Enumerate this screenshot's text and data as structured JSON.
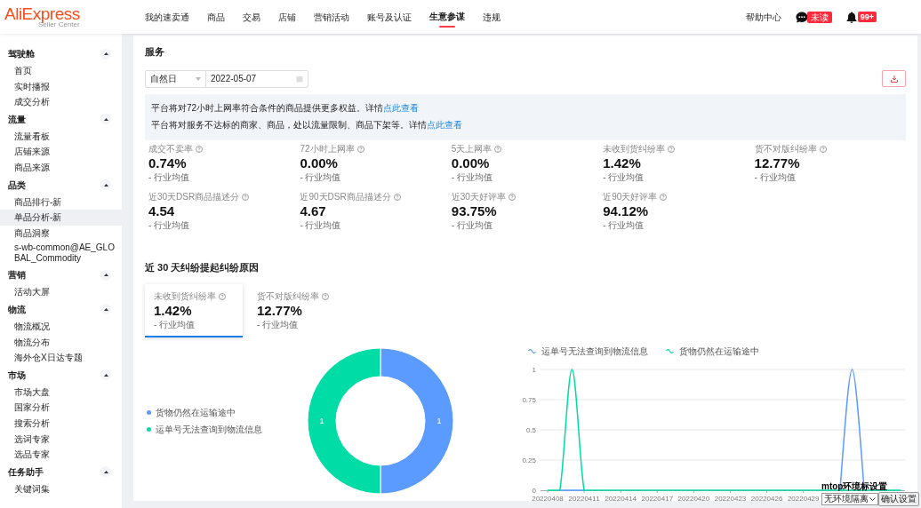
{
  "header": {
    "logo": "AliExpress",
    "logo_subtitle": "Seller Center",
    "nav": [
      {
        "label": "我的速卖通",
        "selected": false
      },
      {
        "label": "商品",
        "selected": false
      },
      {
        "label": "交易",
        "selected": false
      },
      {
        "label": "店铺",
        "selected": false
      },
      {
        "label": "营销活动",
        "selected": false
      },
      {
        "label": "账号及认证",
        "selected": false
      },
      {
        "label": "生意参谋",
        "selected": true
      },
      {
        "label": "违规",
        "selected": false
      }
    ],
    "help": "帮助中心",
    "messages_badge": "未读",
    "notifications_badge": "99+"
  },
  "sidebar": {
    "groups": [
      {
        "label": "驾驶舱",
        "expanded": true,
        "items": [
          {
            "label": "首页",
            "selected": false
          },
          {
            "label": "实时播报",
            "selected": false
          },
          {
            "label": "成交分析",
            "selected": false
          }
        ]
      },
      {
        "label": "流量",
        "expanded": true,
        "items": [
          {
            "label": "流量看板",
            "selected": false
          },
          {
            "label": "店铺来源",
            "selected": false
          },
          {
            "label": "商品来源",
            "selected": false
          }
        ]
      },
      {
        "label": "品类",
        "expanded": true,
        "items": [
          {
            "label": "商品排行-新",
            "selected": false
          },
          {
            "label": "单品分析-新",
            "selected": true
          },
          {
            "label": "商品洞察",
            "selected": false
          },
          {
            "label": "s-wb-common@AE_GLOBAL_Commodity",
            "selected": false
          }
        ]
      },
      {
        "label": "营销",
        "expanded": true,
        "items": [
          {
            "label": "活动大屏",
            "selected": false
          }
        ]
      },
      {
        "label": "物流",
        "expanded": true,
        "items": [
          {
            "label": "物流概况",
            "selected": false
          },
          {
            "label": "物流分布",
            "selected": false
          },
          {
            "label": "海外仓X日达专题",
            "selected": false
          }
        ]
      },
      {
        "label": "市场",
        "expanded": true,
        "items": [
          {
            "label": "市场大盘",
            "selected": false
          },
          {
            "label": "国家分析",
            "selected": false
          },
          {
            "label": "搜索分析",
            "selected": false
          },
          {
            "label": "选词专家",
            "selected": false
          },
          {
            "label": "选品专家",
            "selected": false
          }
        ]
      },
      {
        "label": "任务助手",
        "expanded": true,
        "items": [
          {
            "label": "关键词集",
            "selected": false
          }
        ]
      }
    ]
  },
  "page": {
    "title": "服务",
    "date_filter": {
      "period": "自然日",
      "date": "2022-05-07"
    },
    "notices": [
      {
        "text": "平台将对72小时上网率符合条件的商品提供更多权益。详情",
        "link": "点此查看"
      },
      {
        "text": "平台将对服务不达标的商家、商品，处以流量限制、商品下架等。详情",
        "link": "点此查看"
      }
    ],
    "metrics": [
      {
        "label": "成交不卖率",
        "value": "0.74%",
        "benchmark": "- 行业均值"
      },
      {
        "label": "72小时上网率",
        "value": "0.00%",
        "benchmark": "- 行业均值"
      },
      {
        "label": "5天上网率",
        "value": "0.00%",
        "benchmark": "- 行业均值"
      },
      {
        "label": "未收到货纠纷率",
        "value": "1.42%",
        "benchmark": "- 行业均值"
      },
      {
        "label": "货不对版纠纷率",
        "value": "12.77%",
        "benchmark": "- 行业均值"
      },
      {
        "label": "近30天DSR商品描述分",
        "value": "4.54",
        "benchmark": "- 行业均值"
      },
      {
        "label": "近90天DSR商品描述分",
        "value": "4.67",
        "benchmark": "- 行业均值"
      },
      {
        "label": "近30天好评率",
        "value": "93.75%",
        "benchmark": "- 行业均值"
      },
      {
        "label": "近90天好评率",
        "value": "94.12%",
        "benchmark": "- 行业均值"
      }
    ]
  },
  "dispute_section": {
    "title": "近 30 天纠纷提起纠纷原因",
    "tabs": [
      {
        "label": "未收到货纠纷率",
        "value": "1.42%",
        "benchmark": "- 行业均值",
        "selected": true
      },
      {
        "label": "货不对版纠纷率",
        "value": "12.77%",
        "benchmark": "- 行业均值",
        "selected": false
      }
    ],
    "donut": {
      "chart_data": {
        "type": "donut",
        "categories": [
          "货物仍然在运输途中",
          "运单号无法查询到物流信息"
        ],
        "values": [
          1,
          1
        ],
        "colors": [
          "#5b9bff",
          "#00dca6"
        ],
        "data_labels": true,
        "legend": true
      }
    },
    "line": {
      "chart_data": {
        "type": "line",
        "categories": [
          "20220408",
          null,
          null,
          "20220411",
          null,
          null,
          "20220414",
          null,
          null,
          "20220417",
          null,
          null,
          "20220420",
          null,
          null,
          "20220423",
          null,
          null,
          "20220426",
          null,
          null,
          "20220429",
          null,
          null,
          null,
          null,
          null,
          null,
          null,
          null
        ],
        "series": [
          {
            "name": "运单号无法查询到物流信息",
            "color": "#5b9bff",
            "values": [
              null,
              0,
              0,
              0,
              null,
              null,
              null,
              null,
              null,
              null,
              null,
              null,
              null,
              null,
              null,
              null,
              null,
              null,
              null,
              null,
              null,
              null,
              null,
              null,
              0,
              1,
              0,
              null,
              null,
              null
            ]
          },
          {
            "name": "货物仍然在运输途中",
            "color": "#00dca6",
            "values": [
              0,
              0,
              1,
              0,
              0,
              0,
              0,
              0,
              0,
              0,
              0,
              0,
              0,
              0,
              0,
              0,
              0,
              0,
              0,
              0,
              0,
              0,
              0,
              0,
              0,
              0,
              0,
              0,
              0,
              0
            ]
          }
        ],
        "ylim": [
          0,
          1
        ],
        "yticks": [
          0,
          0.25,
          0.5,
          0.75,
          1
        ],
        "grid": true,
        "legend": true
      }
    }
  },
  "env_panel": {
    "label": "mtop环境标设置",
    "select_value": "无环境隔离",
    "button": "确认设置"
  }
}
